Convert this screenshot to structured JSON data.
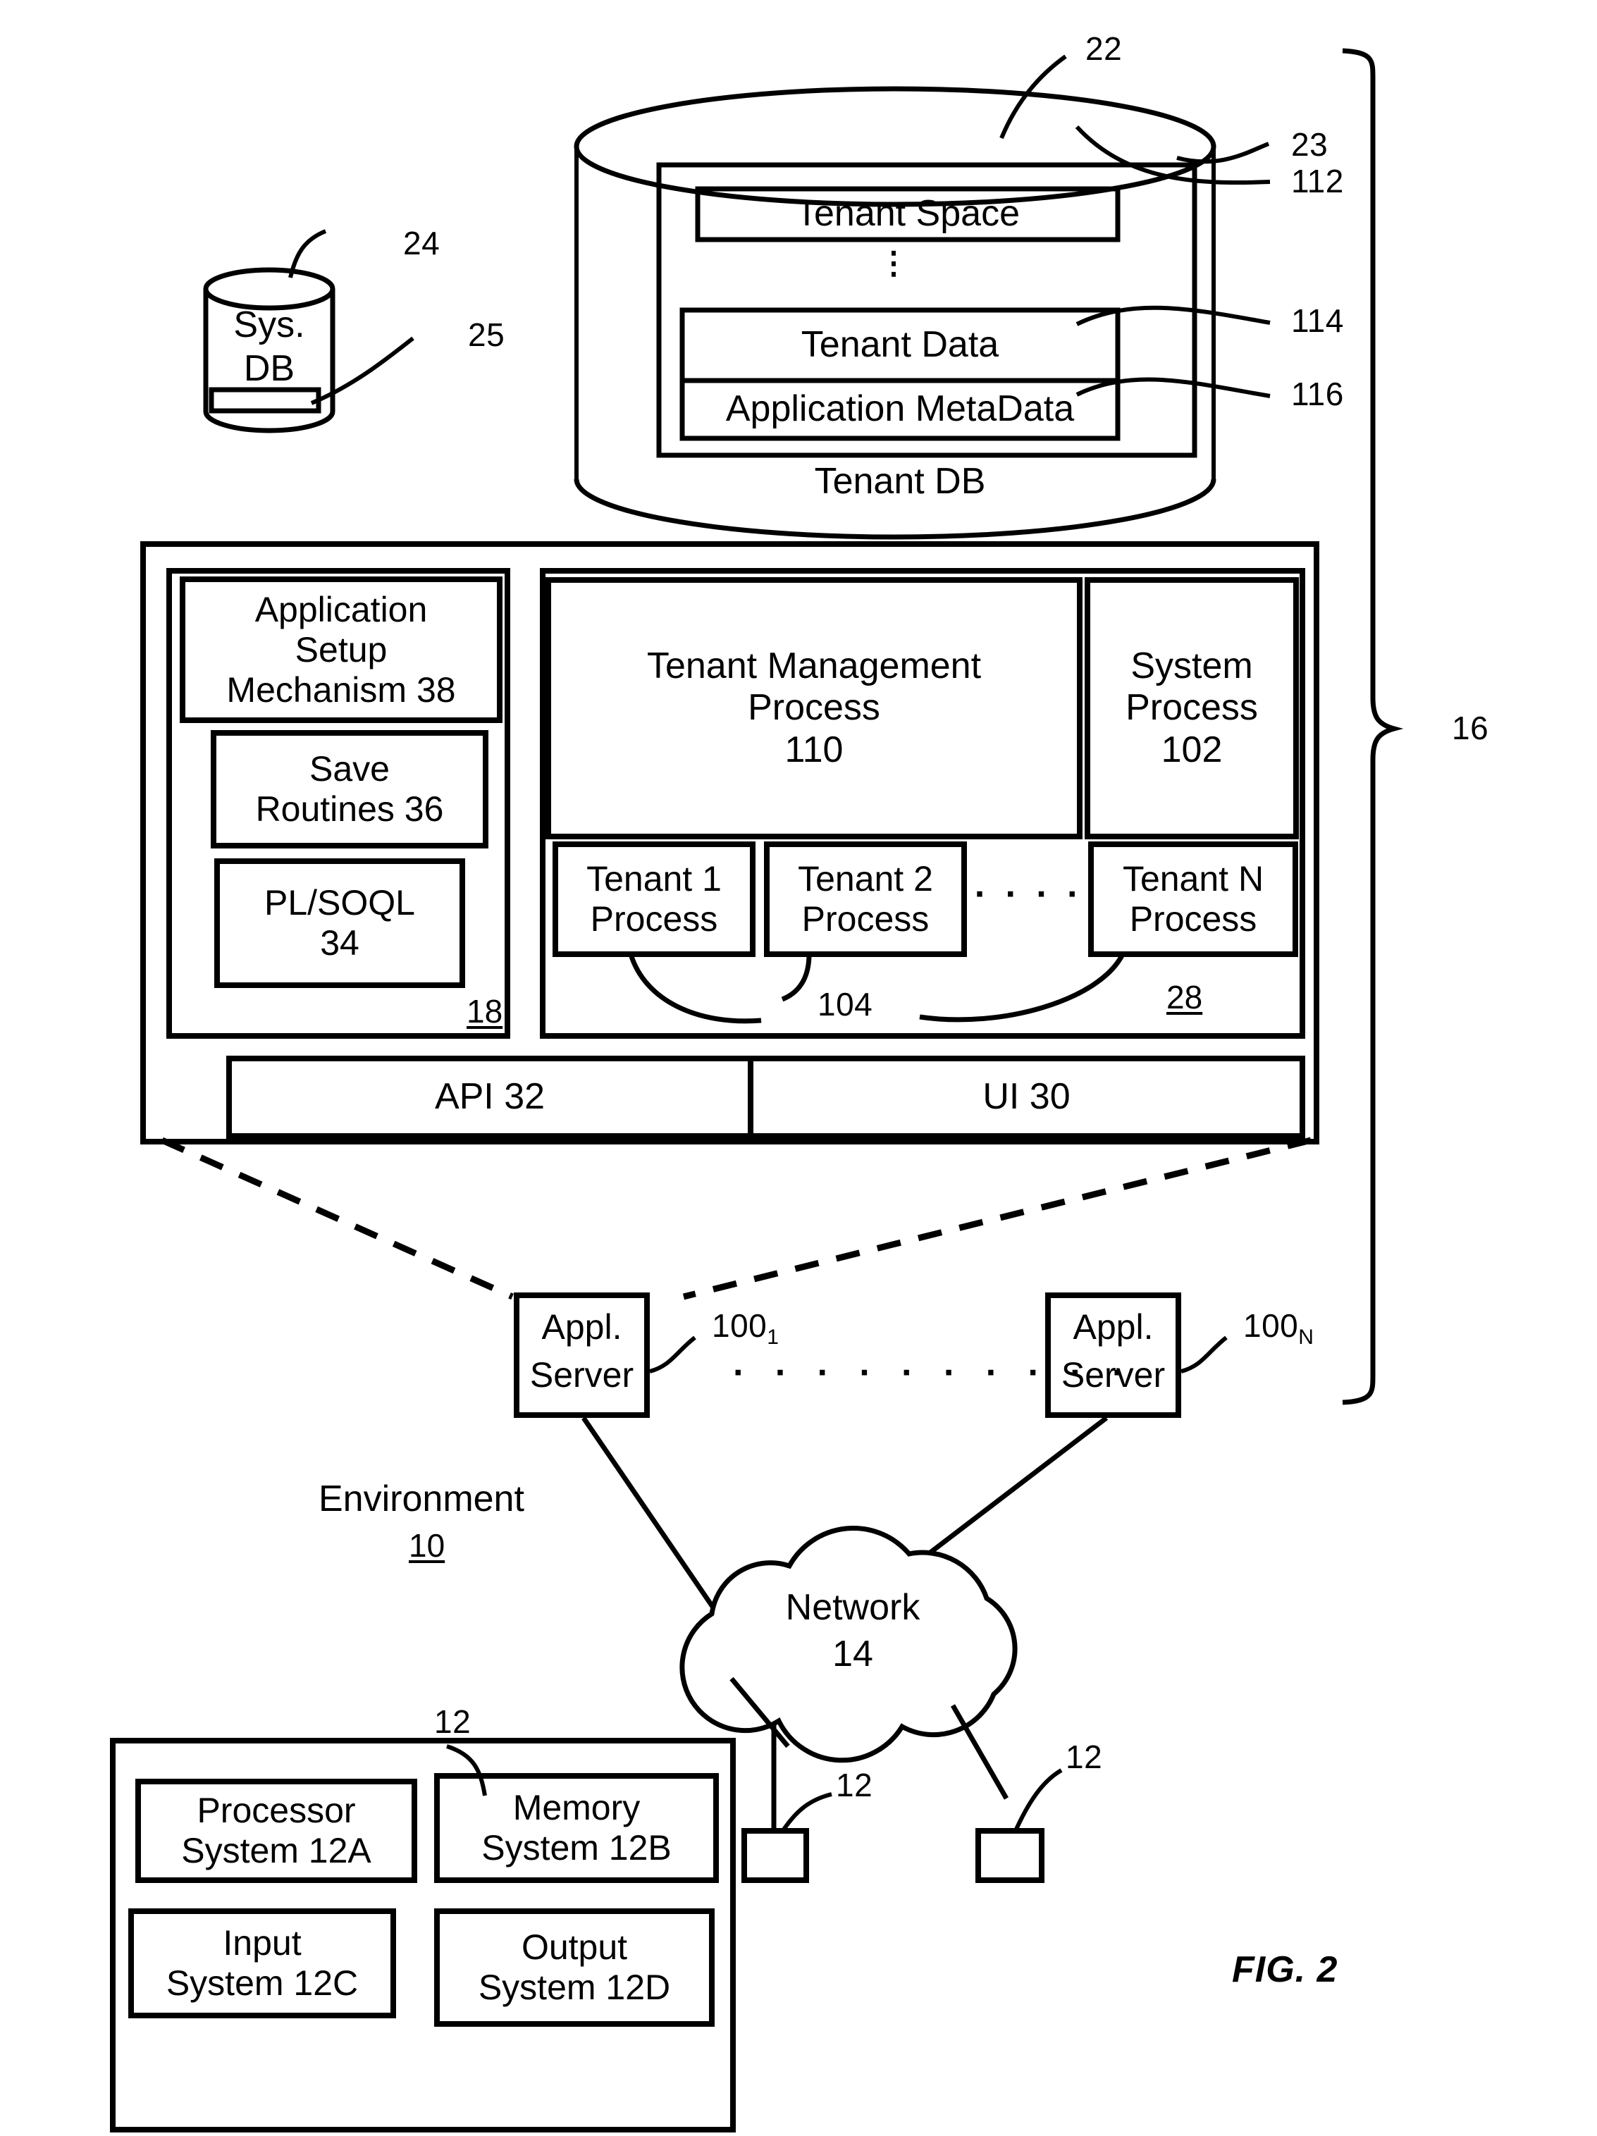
{
  "figure": {
    "caption": "FIG. 2"
  },
  "tenant_db": {
    "ref_top": "22",
    "ref_outer_block": "23",
    "title": "Tenant DB",
    "blocks": [
      {
        "label": "Tenant Space",
        "ref": "112"
      },
      {
        "label": "Tenant Data",
        "ref": "114"
      },
      {
        "label": "Application MetaData",
        "ref": "116"
      }
    ],
    "vertical_ellipsis": "⋮"
  },
  "sys_db": {
    "line1": "Sys.",
    "line2": "DB",
    "ref_cylinder": "24",
    "ref_slot": "25"
  },
  "system_brace": {
    "ref": "16"
  },
  "server_block": {
    "process_space_ref": "18",
    "tenant_processes_ref": "28",
    "tenant_process_ref": "104",
    "setup": [
      {
        "label": "Application\nSetup\nMechanism 38",
        "name": "application-setup-mechanism"
      },
      {
        "label": "Save\nRoutines 36",
        "name": "save-routines"
      },
      {
        "label": "PL/SOQL\n34",
        "name": "pl-soql"
      }
    ],
    "tenant_management_process": "Tenant Management\nProcess\n110",
    "system_process": "System\nProcess\n102",
    "tenant_processes": [
      {
        "label": "Tenant 1\nProcess"
      },
      {
        "label": "Tenant 2\nProcess"
      },
      {
        "label": "Tenant N\nProcess"
      }
    ],
    "tenant_process_dots": "· · · ·",
    "api": "API 32",
    "ui": "UI 30"
  },
  "app_servers": {
    "first": {
      "line1": "Appl.",
      "line2": "Server",
      "ref_base": "100",
      "ref_sub": "1"
    },
    "last": {
      "line1": "Appl.",
      "line2": "Server",
      "ref_base": "100",
      "ref_sub": "N"
    },
    "dots": "· · · · · · · · · ·"
  },
  "environment": {
    "label": "Environment",
    "ref": "10"
  },
  "network": {
    "label": "Network",
    "ref": "14"
  },
  "user_system": {
    "ref": "12",
    "cells": [
      {
        "label": "Processor\nSystem 12A"
      },
      {
        "label": "Memory\nSystem 12B"
      },
      {
        "label": "Input\nSystem 12C"
      },
      {
        "label": "Output\nSystem 12D"
      }
    ]
  },
  "user_terminals": [
    {
      "ref": "12"
    },
    {
      "ref": "12"
    }
  ]
}
